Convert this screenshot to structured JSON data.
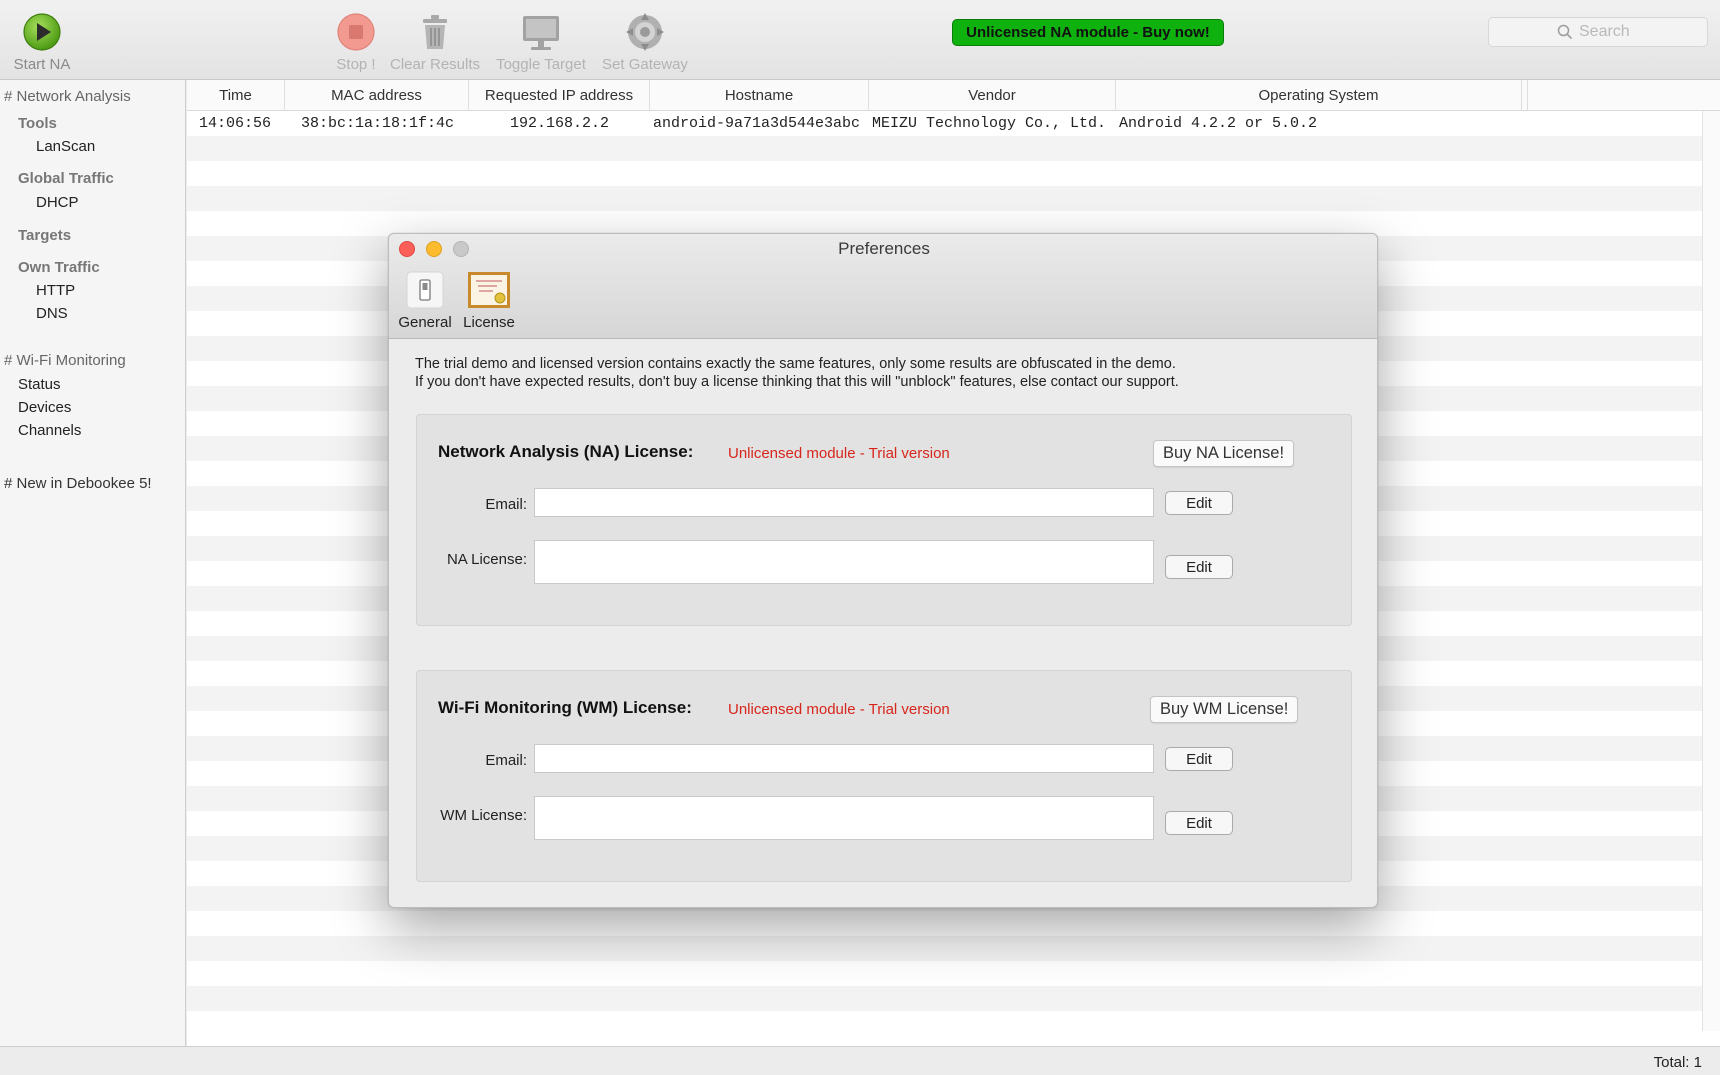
{
  "toolbar": {
    "start": "Start NA",
    "stop": "Stop !",
    "clear": "Clear Results",
    "toggle": "Toggle Target",
    "gateway": "Set Gateway",
    "banner": "Unlicensed NA module - Buy now!",
    "search_placeholder": "Search"
  },
  "sidebar": {
    "network_analysis": "# Network Analysis",
    "tools": "Tools",
    "lanscan": "LanScan",
    "global_traffic": "Global Traffic",
    "dhcp": "DHCP",
    "targets": "Targets",
    "own_traffic": "Own Traffic",
    "http": "HTTP",
    "dns": "DNS",
    "wifi_monitoring": "# Wi-Fi Monitoring",
    "status": "Status",
    "devices": "Devices",
    "channels": "Channels",
    "new_in": "# New in Debookee 5!"
  },
  "table": {
    "columns": [
      "Time",
      "MAC address",
      "Requested IP address",
      "Hostname",
      "Vendor",
      "Operating System"
    ],
    "rows": [
      [
        "14:06:56",
        "38:bc:1a:18:1f:4c",
        "192.168.2.2",
        "android-9a71a3d544e3abc",
        "MEIZU Technology Co., Ltd.",
        "Android 4.2.2 or 5.0.2"
      ]
    ]
  },
  "status": {
    "total": "Total: 1"
  },
  "dialog": {
    "title": "Preferences",
    "tabs": [
      "General",
      "License"
    ],
    "intro_line1": "The trial demo and licensed version contains exactly the same features, only some results are obfuscated in the demo.",
    "intro_line2": "If you don't have expected results, don't buy a license thinking that this will \"unblock\" features, else contact our support.",
    "na": {
      "title": "Network Analysis (NA) License:",
      "status": "Unlicensed module - Trial version",
      "buy": "Buy NA License!",
      "email_label": "Email:",
      "license_label": "NA License:",
      "email_value": "",
      "license_value": ""
    },
    "wm": {
      "title": "Wi-Fi Monitoring (WM) License:",
      "status": "Unlicensed module - Trial version",
      "buy": "Buy WM License!",
      "email_label": "Email:",
      "license_label": "WM License:",
      "email_value": "",
      "license_value": ""
    },
    "edit": "Edit"
  },
  "colors": {
    "banner_green": "#0fb10f",
    "status_red": "#d7261c",
    "start_green": "#6cbd1f",
    "stop_red": "#f07a6e"
  },
  "icons": [
    "play-icon",
    "stop-icon",
    "trash-icon",
    "monitor-icon",
    "crosshair-icon",
    "search-icon",
    "switch-icon",
    "certificate-icon"
  ]
}
